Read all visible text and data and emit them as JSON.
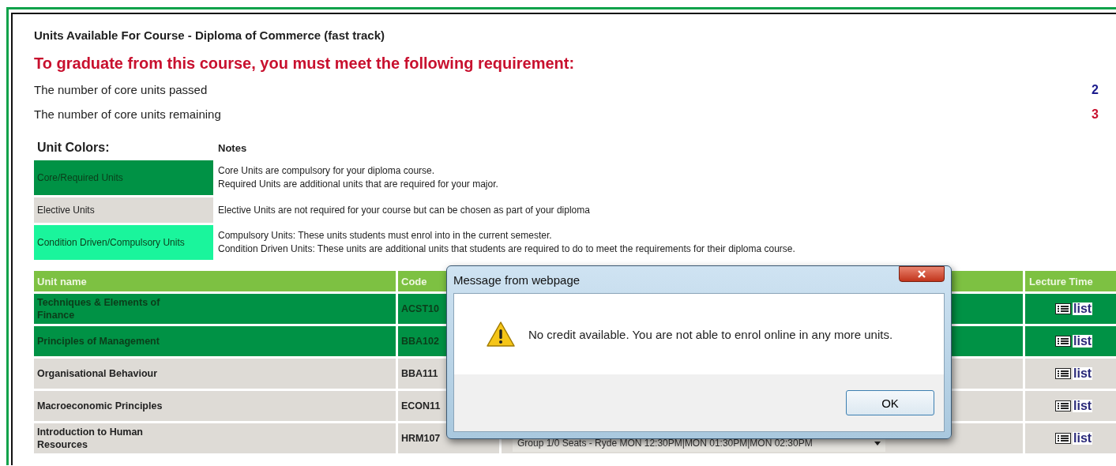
{
  "page": {
    "title": "Units Available For Course - Diploma of Commerce (fast track)",
    "requirement": "To graduate from this course, you must meet the following requirement:"
  },
  "counts": [
    {
      "label": "The number of core units passed",
      "value": "2",
      "kind": "passed"
    },
    {
      "label": "The number of core units remaining",
      "value": "3",
      "kind": "remaining"
    }
  ],
  "legend": {
    "heading": "Unit Colors:",
    "notes_heading": "Notes",
    "items": [
      {
        "label": "Core/Required Units",
        "color": "#009245",
        "notes": [
          "Core Units are compulsory for your diploma course.",
          "Required Units are additional units that are required for your major."
        ]
      },
      {
        "label": "Elective Units",
        "color": "#dedbd6",
        "notes": [
          "Elective Units are not required for your course but can be chosen as part of your diploma"
        ]
      },
      {
        "label": "Condition Driven/Compulsory Units",
        "color": "#1af59c",
        "notes": [
          "Compulsory Units: These units students must enrol into in the current semester.",
          "Condition Driven Units: These units are additional units that students are required to do to meet the requirements for their diploma course."
        ]
      }
    ]
  },
  "table": {
    "columns": [
      "Unit name",
      "Code",
      "Lecture Time"
    ],
    "rows": [
      {
        "name": "Techniques & Elements of Finance",
        "code": "ACST10",
        "color": "#009245",
        "group": "",
        "link": "list"
      },
      {
        "name": "Principles of Management",
        "code": "BBA102",
        "color": "#009245",
        "group": "",
        "link": "list"
      },
      {
        "name": "Organisational Behaviour",
        "code": "BBA111",
        "color": "#dedbd6",
        "group": "",
        "link": "list"
      },
      {
        "name": "Macroeconomic Principles",
        "code": "ECON11",
        "color": "#dedbd6",
        "group": "",
        "link": "list"
      },
      {
        "name": "Introduction to Human Resources",
        "code": "HRM107",
        "color": "#dedbd6",
        "group": "Group 1/0 Seats - Ryde MON 12:30PM|MON 01:30PM|MON 02:30PM",
        "link": "list"
      }
    ]
  },
  "dialog": {
    "title": "Message from webpage",
    "message": "No credit available. You are not able to enrol online in any more units.",
    "button": "OK"
  }
}
